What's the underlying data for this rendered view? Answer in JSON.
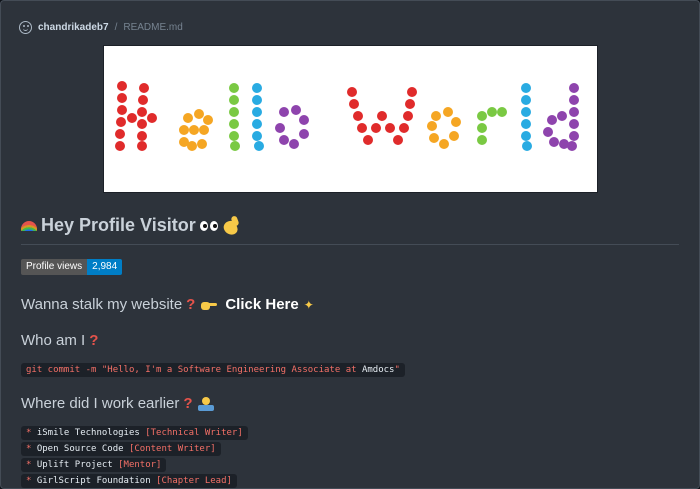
{
  "file_header": {
    "owner": "chandrikadeb7",
    "separator": "/",
    "filename": "README.md",
    "icon": "smiley-icon"
  },
  "banner": {
    "alt_text": "Hello World",
    "colors": [
      "#e02b2b",
      "#f5a623",
      "#7ac943",
      "#29abe2",
      "#8e44ad"
    ]
  },
  "greeting": {
    "title": "Hey Profile Visitor",
    "icons": [
      "rainbow-icon",
      "eyes-icon",
      "waving-hand-icon"
    ]
  },
  "badge": {
    "label": "Profile views",
    "value": "2,984",
    "label_color": "#555555",
    "value_color": "#007ec6"
  },
  "website": {
    "question": "Wanna stalk my website",
    "link_text": "Click Here"
  },
  "who": {
    "question": "Who am I",
    "command_prefix": "git commit -m \"Hello, I'm a Software Engineering Associate at ",
    "command_company": "Amdocs",
    "command_suffix": "\""
  },
  "work": {
    "question": "Where did I work earlier",
    "items": [
      {
        "org": "iSmile Technologies",
        "role": "[Technical Writer]"
      },
      {
        "org": "Open Source Code",
        "role": "[Content Writer]"
      },
      {
        "org": "Uplift Project",
        "role": "[Mentor]"
      },
      {
        "org": "GirlScript Foundation",
        "role": "[Chapter Lead]"
      }
    ]
  },
  "colors": {
    "background": "#2d333b",
    "accent_red": "#f47067",
    "text": "#c9d1d9"
  }
}
